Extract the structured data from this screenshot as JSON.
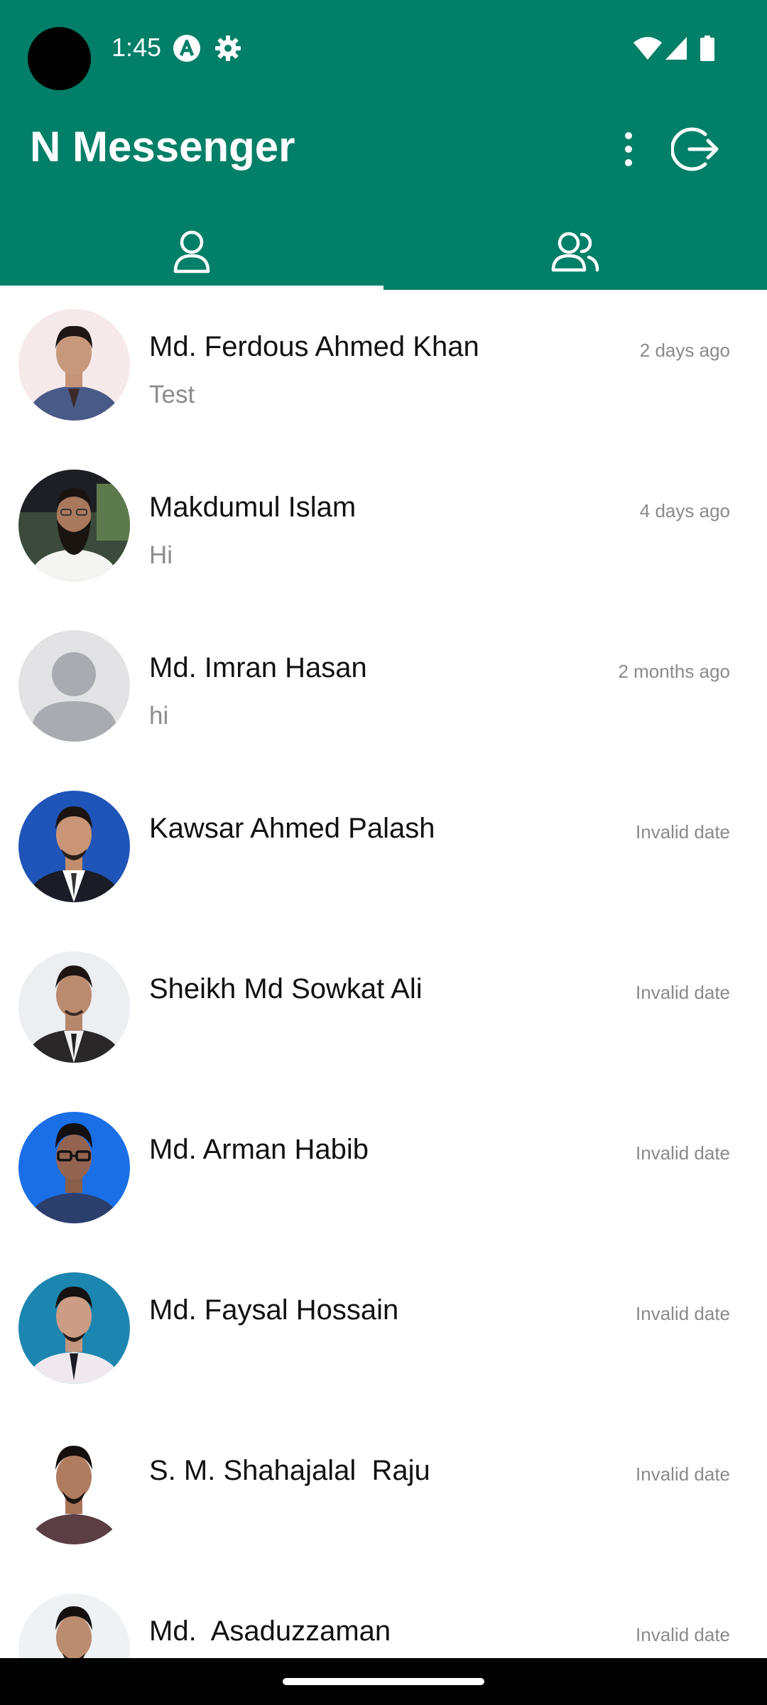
{
  "status_bar": {
    "time": "1:45",
    "icons": [
      "app-a-icon",
      "settings-gear-icon",
      "wifi-icon",
      "signal-icon",
      "battery-icon"
    ]
  },
  "app_bar": {
    "title": "N Messenger",
    "bg_color": "#017f68",
    "actions": [
      "more-vert-icon",
      "logout-icon"
    ]
  },
  "tabs": [
    {
      "icon": "person-icon",
      "selected": true
    },
    {
      "icon": "group-icon",
      "selected": false
    }
  ],
  "conversations": [
    {
      "name": "Md. Ferdous Ahmed Khan",
      "last_message": "Test",
      "time": "2 days ago"
    },
    {
      "name": "Makdumul Islam",
      "last_message": "Hi",
      "time": "4 days ago"
    },
    {
      "name": "Md. Imran Hasan",
      "last_message": "hi",
      "time": "2 months ago"
    },
    {
      "name": "Kawsar Ahmed Palash",
      "last_message": "",
      "time": "Invalid date"
    },
    {
      "name": "Sheikh Md Sowkat Ali",
      "last_message": "",
      "time": "Invalid date"
    },
    {
      "name": "Md. Arman Habib",
      "last_message": "",
      "time": "Invalid date"
    },
    {
      "name": "Md. Faysal Hossain",
      "last_message": "",
      "time": "Invalid date"
    },
    {
      "name": "S. M. Shahajalal  Raju",
      "last_message": "",
      "time": "Invalid date"
    },
    {
      "name": "Md.  Asaduzzaman",
      "last_message": "",
      "time": "Invalid date"
    }
  ]
}
